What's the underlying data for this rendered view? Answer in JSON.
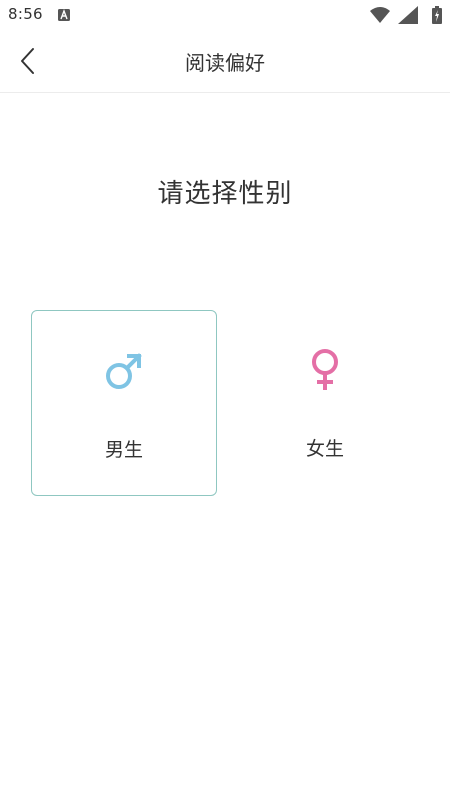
{
  "status_bar": {
    "time": "8:56",
    "notification_icon": "a-icon",
    "right_icons": [
      "wifi-icon",
      "cell-signal-icon",
      "battery-icon"
    ]
  },
  "header": {
    "title": "阅读偏好",
    "back_icon": "chevron-left-icon"
  },
  "prompt": "请选择性别",
  "options": [
    {
      "label": "男生",
      "icon": "male-symbol-icon",
      "icon_color": "#7fc4e4",
      "selected": true
    },
    {
      "label": "女生",
      "icon": "female-symbol-icon",
      "icon_color": "#e46fa6",
      "selected": false
    }
  ],
  "colors": {
    "selected_border": "#8fc7c1",
    "text": "#333333",
    "divider": "#ececec"
  }
}
